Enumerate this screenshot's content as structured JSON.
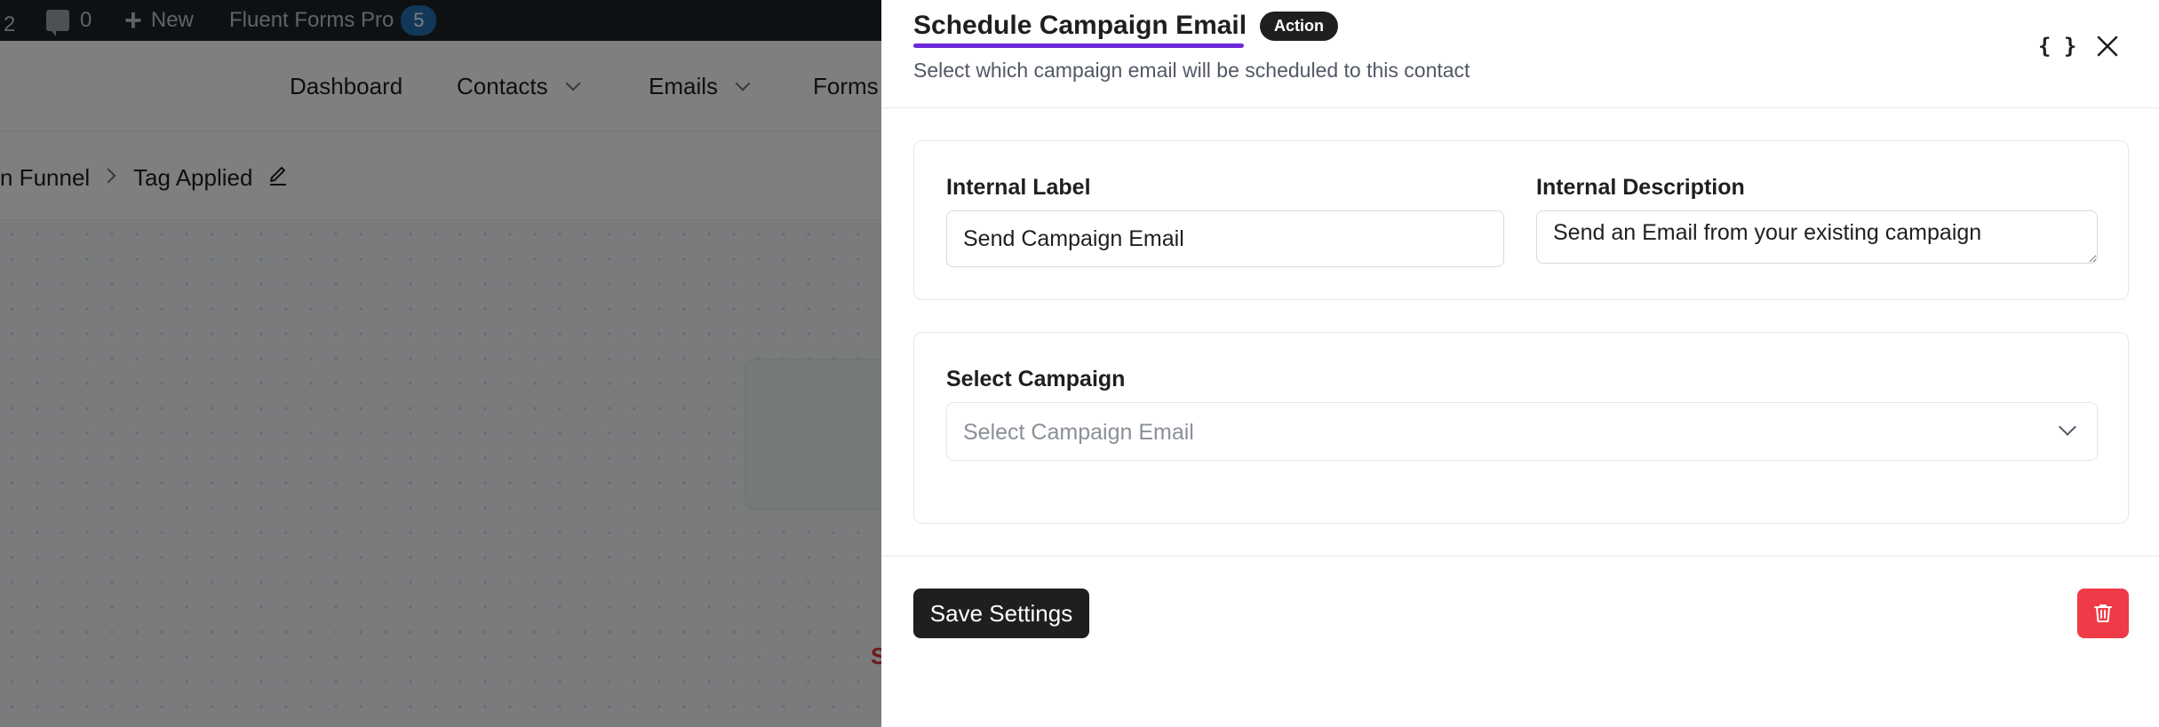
{
  "admin_bar": {
    "count": "2",
    "comments_count": "0",
    "new_label": "New",
    "plugin_name": "Fluent Forms Pro",
    "plugin_badge": "5",
    "icons": [
      "comment-icon",
      "plus-icon"
    ]
  },
  "nav": {
    "items": [
      {
        "label": "Dashboard"
      },
      {
        "label": "Contacts"
      },
      {
        "label": "Emails"
      },
      {
        "label": "Forms"
      }
    ]
  },
  "breadcrumb": {
    "parent": "n Funnel",
    "current": "Tag Applied",
    "icons": [
      "chevron-right-icon",
      "edit-icon"
    ]
  },
  "canvas": {
    "card_text": "S"
  },
  "drawer": {
    "title": "Schedule Campaign Email",
    "badge": "Action",
    "subtitle": "Select which campaign email will be scheduled to this contact",
    "braces_label": "{ }",
    "icons": [
      "braces-icon",
      "close-icon",
      "chevron-down-icon",
      "trash-icon"
    ],
    "internal_label": {
      "label": "Internal Label",
      "value": "Send Campaign Email"
    },
    "internal_description": {
      "label": "Internal Description",
      "value": "Send an Email from your existing campaign"
    },
    "select_campaign": {
      "label": "Select Campaign",
      "placeholder": "Select Campaign Email"
    },
    "save_label": "Save Settings"
  },
  "colors": {
    "accent_underline": "#6d28d9",
    "dark": "#1e1f21",
    "danger": "#ef3a47",
    "admin_badge": "#2271b1"
  }
}
